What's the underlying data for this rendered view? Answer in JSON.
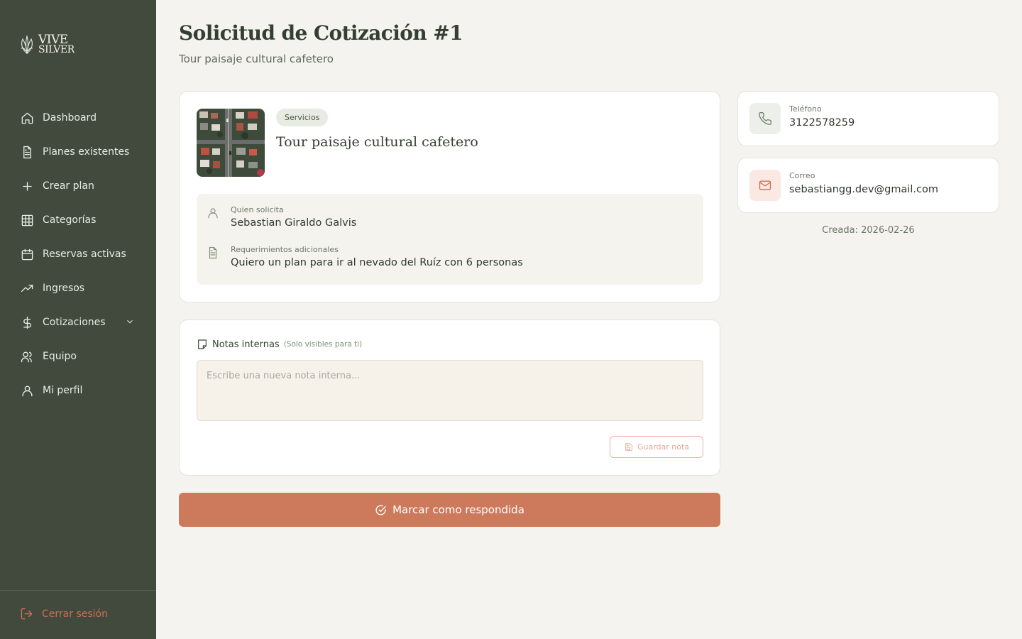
{
  "brand": {
    "line1": "VIVE",
    "line2": "SILVER"
  },
  "sidebar": {
    "items": [
      {
        "label": "Dashboard",
        "icon": "home-icon"
      },
      {
        "label": "Planes existentes",
        "icon": "file-text-icon"
      },
      {
        "label": "Crear plan",
        "icon": "plus-icon"
      },
      {
        "label": "Categorías",
        "icon": "grid-icon"
      },
      {
        "label": "Reservas activas",
        "icon": "calendar-icon"
      },
      {
        "label": "Ingresos",
        "icon": "trending-up-icon"
      },
      {
        "label": "Cotizaciones",
        "icon": "dollar-icon"
      },
      {
        "label": "Equipo",
        "icon": "users-icon"
      },
      {
        "label": "Mi perfil",
        "icon": "user-icon"
      }
    ],
    "logout_label": "Cerrar sesión"
  },
  "header": {
    "title": "Solicitud de Cotización #1",
    "subtitle": "Tour paisaje cultural cafetero"
  },
  "request": {
    "category_badge": "Servicios",
    "plan_name": "Tour paisaje cultural cafetero",
    "requester_label": "Quien solicita",
    "requester_name": "Sebastian Giraldo Galvis",
    "requirements_label": "Requerimientos adicionales",
    "requirements": "Quiero un plan para ir al nevado del Ruíz con 6 personas"
  },
  "notes": {
    "title": "Notas internas",
    "hint": "(Solo visibles para ti)",
    "placeholder": "Escribe una nueva nota interna...",
    "save_label": "Guardar nota"
  },
  "actions": {
    "mark_answered_label": "Marcar como respondida"
  },
  "contact": {
    "phone_label": "Teléfono",
    "phone": "3122578259",
    "email_label": "Correo",
    "email": "sebastiangg.dev@gmail.com",
    "created": "Creada: 2026-02-26"
  },
  "colors": {
    "sidebar_bg": "#414a3c",
    "page_bg": "#f4f3ef",
    "accent": "#cd7a5c",
    "badge_bg": "#e7ebe2"
  }
}
